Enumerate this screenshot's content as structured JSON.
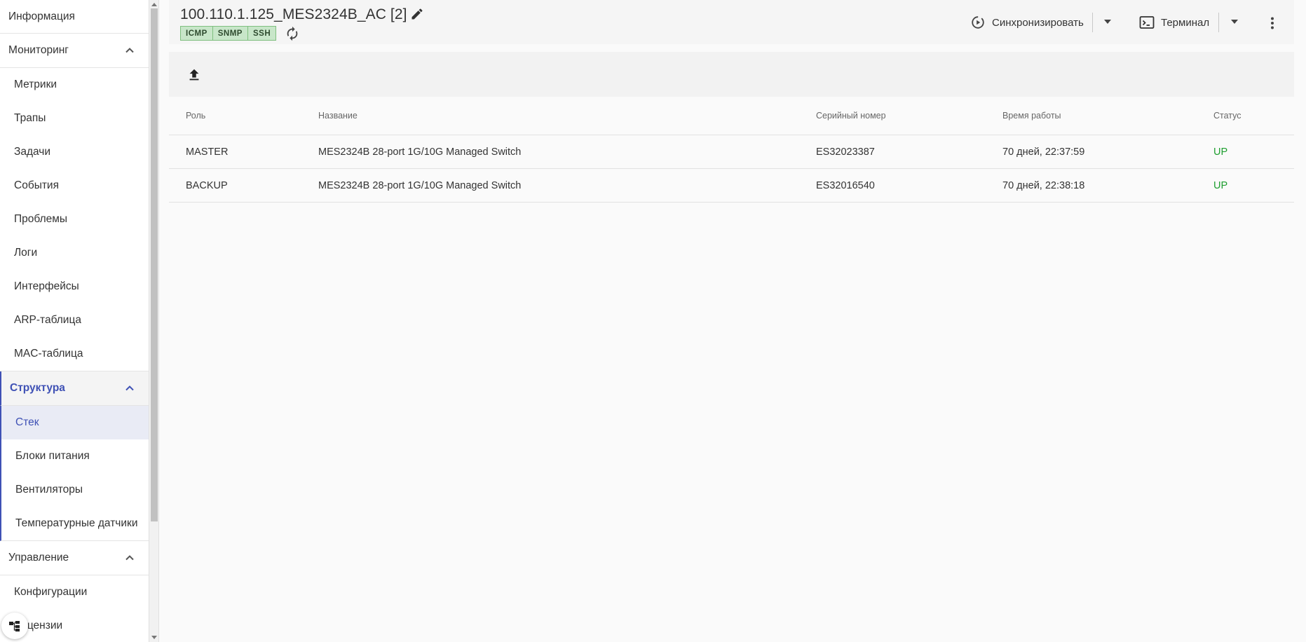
{
  "sidebar": {
    "info": "Информация",
    "monitoring": {
      "title": "Мониторинг",
      "items": [
        "Метрики",
        "Трапы",
        "Задачи",
        "События",
        "Проблемы",
        "Логи",
        "Интерфейсы",
        "ARP-таблица",
        "MAC-таблица"
      ]
    },
    "structure": {
      "title": "Структура",
      "items": [
        "Стек",
        "Блоки питания",
        "Вентиляторы",
        "Температурные датчики"
      ],
      "selected": "Стек"
    },
    "management": {
      "title": "Управление",
      "items": [
        "Конфигурации",
        "Лицензии"
      ]
    }
  },
  "header": {
    "title": "100.110.1.125_MES2324B_AC [2]",
    "badges": [
      "ICMP",
      "SNMP",
      "SSH"
    ],
    "sync_label": "Синхронизировать",
    "terminal_label": "Терминал"
  },
  "table": {
    "columns": [
      "Роль",
      "Название",
      "Серийный номер",
      "Время работы",
      "Статус"
    ],
    "rows": [
      [
        "MASTER",
        "MES2324B 28-port 1G/10G Managed Switch",
        "ES32023387",
        "70 дней, 22:37:59",
        "UP"
      ],
      [
        "BACKUP",
        "MES2324B 28-port 1G/10G Managed Switch",
        "ES32016540",
        "70 дней, 22:38:18",
        "UP"
      ]
    ]
  },
  "colors": {
    "accent": "#3f51b5",
    "status_up": "#1e9e2f",
    "badge_bg": "#c8e6c9"
  },
  "icons": {
    "edit": "pencil-icon",
    "refresh": "refresh-icon",
    "sync": "sync-icon",
    "terminal": "terminal-icon",
    "more": "more-vert-icon",
    "upload": "upload-icon",
    "tree": "tree-icon"
  }
}
